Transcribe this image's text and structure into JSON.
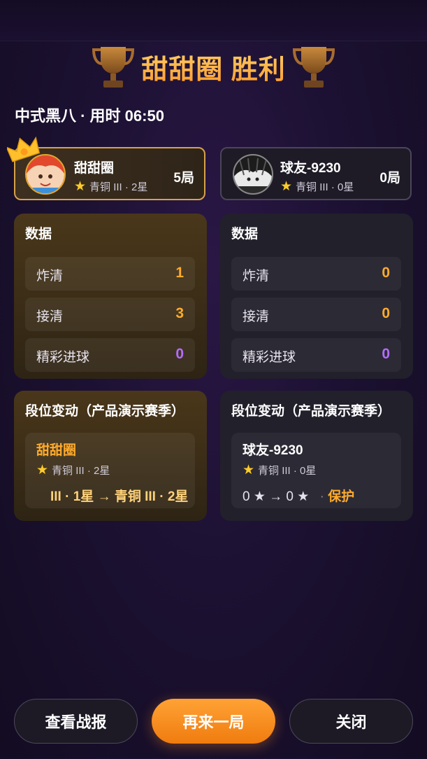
{
  "result": {
    "winner_name": "甜甜圈",
    "result_word": "胜利"
  },
  "match_info": "中式黑八 · 用时 06:50",
  "players": {
    "left": {
      "name": "甜甜圈",
      "rank": "青铜 III · 2星",
      "score": "5局"
    },
    "right": {
      "name": "球友-9230",
      "rank": "青铜 III · 0星",
      "score": "0局"
    }
  },
  "stats": {
    "title": "数据",
    "labels": [
      "炸清",
      "接清",
      "精彩进球"
    ],
    "left_values": [
      "1",
      "3",
      "0"
    ],
    "right_values": [
      "0",
      "0",
      "0"
    ]
  },
  "rank_change": {
    "title": "段位变动（产品演示赛季）",
    "left": {
      "name": "甜甜圈",
      "rank": "青铜 III · 2星",
      "change": "III · 1星 → 青铜 III · 2星"
    },
    "right": {
      "name": "球友-9230",
      "rank": "青铜 III · 0星",
      "change": "0 ★ → 0 ★",
      "protect": "保护"
    }
  },
  "buttons": {
    "report": "查看战报",
    "again": "再来一局",
    "close": "关闭"
  },
  "colors": {
    "accent": "#ffab2c",
    "purple": "#b46cff",
    "primary_button": "#f48a1e"
  },
  "icons": {
    "trophy": "trophy-icon",
    "crown": "crown-icon",
    "star": "star-icon"
  }
}
